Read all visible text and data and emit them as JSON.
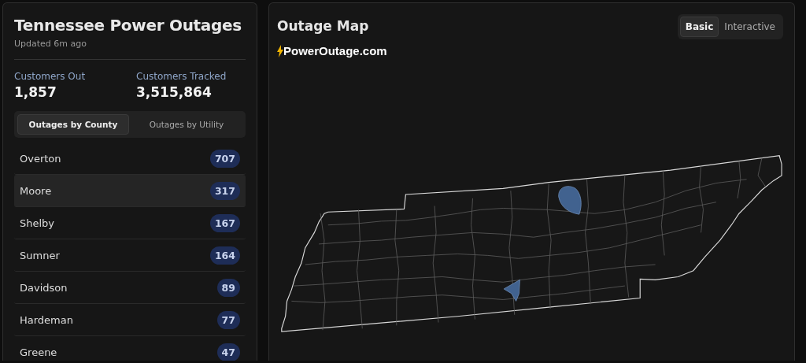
{
  "sidebar": {
    "title": "Tennessee Power Outages",
    "updated": "Updated 6m ago",
    "stats": [
      {
        "label": "Customers Out",
        "value": "1,857"
      },
      {
        "label": "Customers Tracked",
        "value": "3,515,864"
      }
    ],
    "tabs": [
      {
        "label": "Outages by County",
        "selected": true
      },
      {
        "label": "Outages by Utility",
        "selected": false
      }
    ],
    "counties": [
      {
        "name": "Overton",
        "count": "707",
        "selected": false
      },
      {
        "name": "Moore",
        "count": "317",
        "selected": true
      },
      {
        "name": "Shelby",
        "count": "167",
        "selected": false
      },
      {
        "name": "Sumner",
        "count": "164",
        "selected": false
      },
      {
        "name": "Davidson",
        "count": "89",
        "selected": false
      },
      {
        "name": "Hardeman",
        "count": "77",
        "selected": false
      },
      {
        "name": "Greene",
        "count": "47",
        "selected": false
      }
    ]
  },
  "map": {
    "title": "Outage Map",
    "modes": [
      {
        "label": "Basic",
        "selected": true
      },
      {
        "label": "Interactive",
        "selected": false
      }
    ],
    "source": "PowerOutage.com"
  }
}
